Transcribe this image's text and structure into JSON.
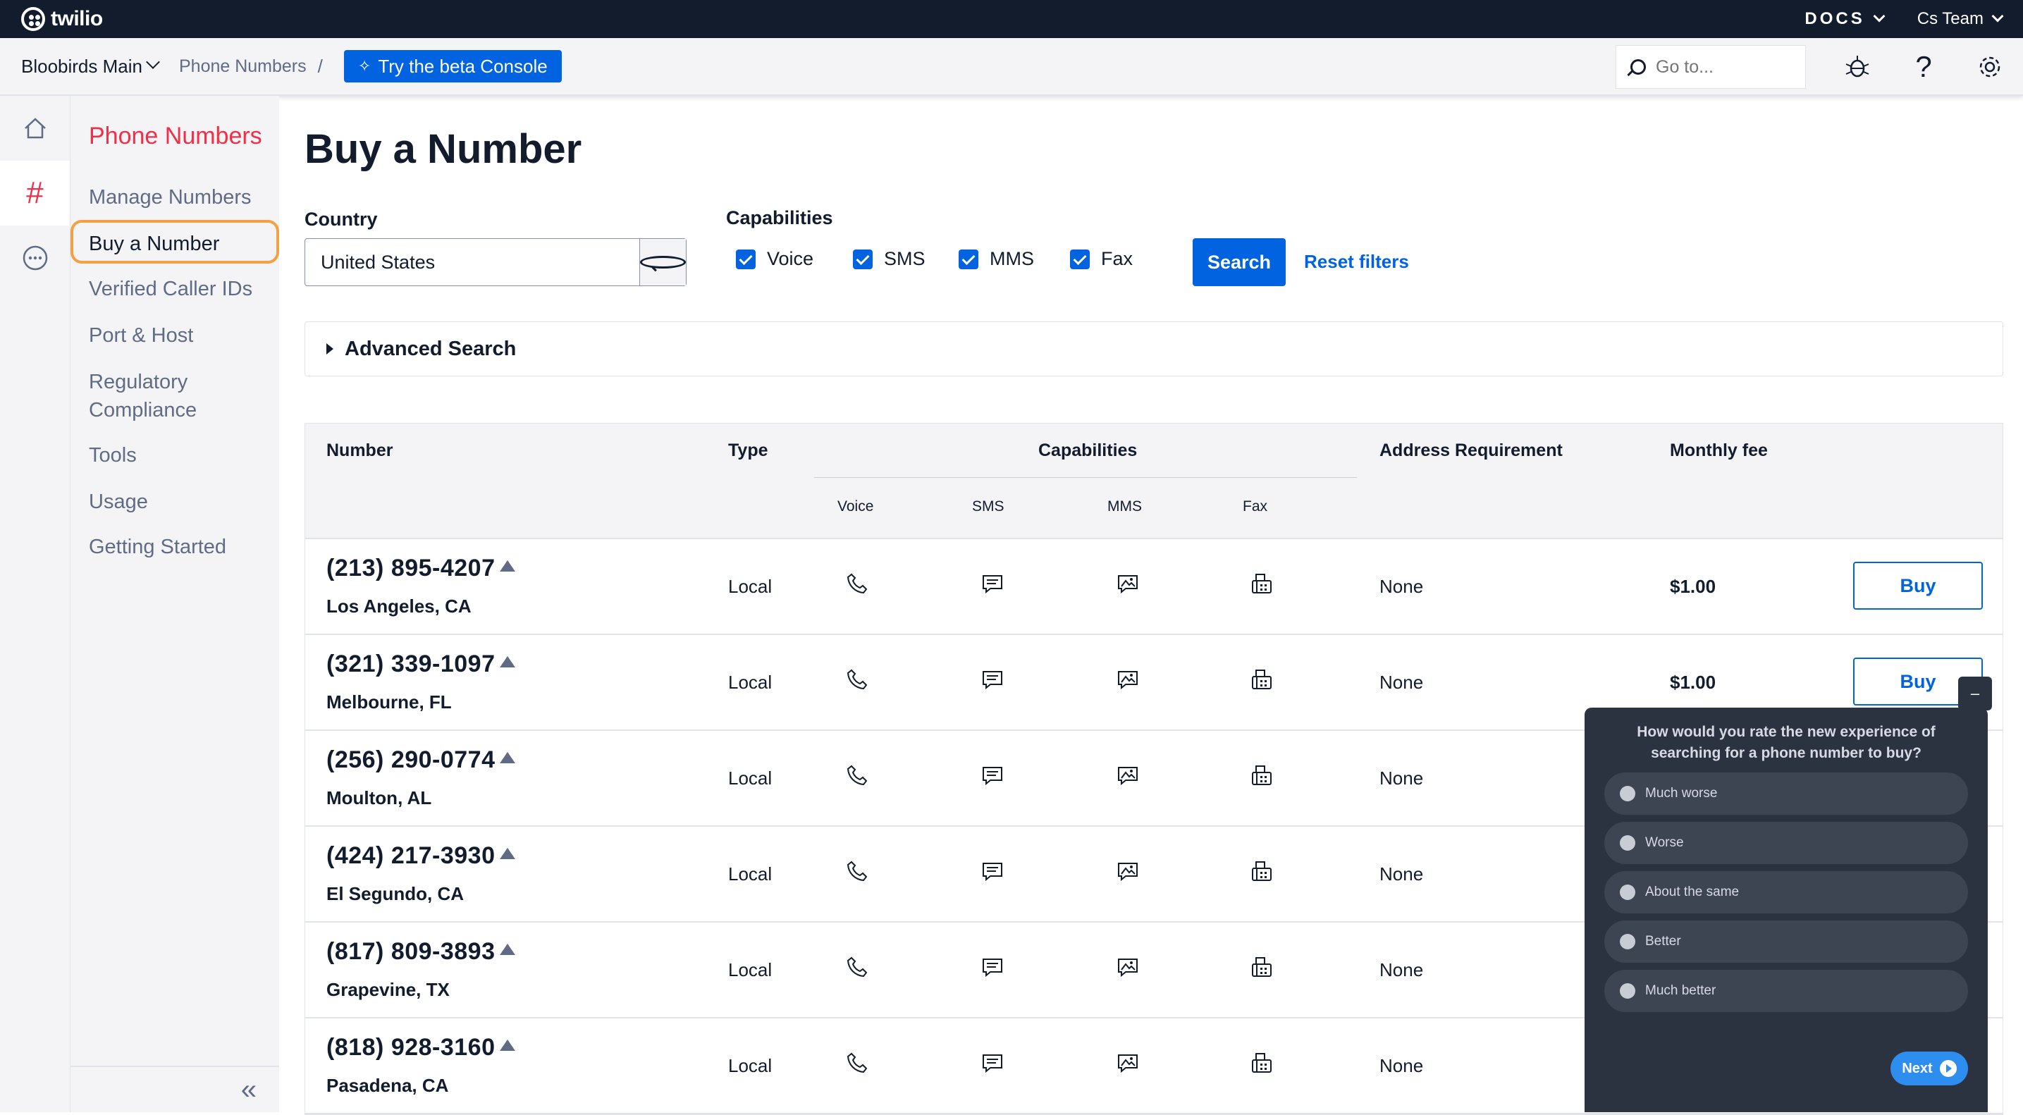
{
  "topbar": {
    "logo": "twilio",
    "docs": "DOCS",
    "team": "Cs Team"
  },
  "subbar": {
    "account": "Bloobirds Main",
    "breadcrumb": "Phone Numbers",
    "separator": "/",
    "beta_button": "Try the beta Console",
    "goto_placeholder": "Go to..."
  },
  "sidenav": {
    "title": "Phone Numbers",
    "items": [
      "Manage Numbers",
      "Buy a Number",
      "Verified Caller IDs",
      "Port & Host",
      "Regulatory",
      "Compliance",
      "Tools",
      "Usage",
      "Getting Started"
    ],
    "collapse": "«"
  },
  "page": {
    "title": "Buy a Number",
    "country_label": "Country",
    "country_value": "United States",
    "capabilities_label": "Capabilities",
    "checkboxes": [
      "Voice",
      "SMS",
      "MMS",
      "Fax"
    ],
    "search_button": "Search",
    "reset_filters": "Reset filters",
    "advanced_search": "Advanced Search"
  },
  "table": {
    "headers": {
      "number": "Number",
      "type": "Type",
      "capabilities": "Capabilities",
      "address": "Address Requirement",
      "fee": "Monthly fee"
    },
    "sub_headers": [
      "Voice",
      "SMS",
      "MMS",
      "Fax"
    ],
    "buy_label": "Buy",
    "rows": [
      {
        "number": "(213) 895-4207",
        "location": "Los Angeles, CA",
        "type": "Local",
        "address": "None",
        "fee": "$1.00"
      },
      {
        "number": "(321) 339-1097",
        "location": "Melbourne, FL",
        "type": "Local",
        "address": "None",
        "fee": "$1.00"
      },
      {
        "number": "(256) 290-0774",
        "location": "Moulton, AL",
        "type": "Local",
        "address": "None",
        "fee": ""
      },
      {
        "number": "(424) 217-3930",
        "location": "El Segundo, CA",
        "type": "Local",
        "address": "None",
        "fee": ""
      },
      {
        "number": "(817) 809-3893",
        "location": "Grapevine, TX",
        "type": "Local",
        "address": "None",
        "fee": ""
      },
      {
        "number": "(818) 928-3160",
        "location": "Pasadena, CA",
        "type": "Local",
        "address": "None",
        "fee": ""
      }
    ]
  },
  "survey": {
    "minimize": "–",
    "question": "How would you rate the new experience of searching for a phone number to buy?",
    "options": [
      "Much worse",
      "Worse",
      "About the same",
      "Better",
      "Much better"
    ],
    "next": "Next"
  },
  "colors": {
    "brand_red": "#f22f46",
    "accent_blue": "#0263e0",
    "nav_dark": "#121c2d",
    "highlight_orange": "#f5a044"
  }
}
